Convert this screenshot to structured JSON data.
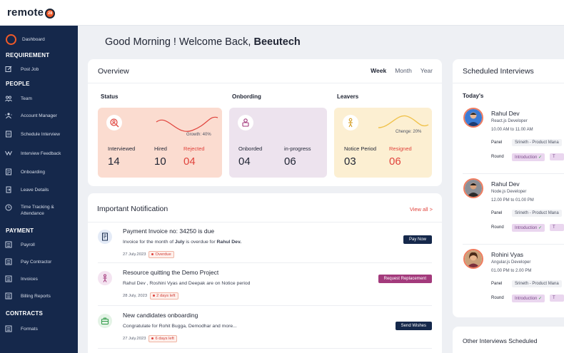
{
  "brand": {
    "name": "remote",
    "badge": "28"
  },
  "sidebar": {
    "dashboard": "Dashboard",
    "sections": [
      {
        "title": "REQUIREMENT",
        "items": [
          {
            "label": "Post Job",
            "icon": "edit-icon"
          }
        ]
      },
      {
        "title": "PEOPLE",
        "items": [
          {
            "label": "Team",
            "icon": "team-icon"
          },
          {
            "label": "Account Manager",
            "icon": "account-manager-icon"
          },
          {
            "label": "Schedule Interview",
            "icon": "calendar-icon"
          },
          {
            "label": "Interview Feedback",
            "icon": "feedback-icon"
          },
          {
            "label": "Onboarding",
            "icon": "onboarding-icon"
          },
          {
            "label": "Leave Details",
            "icon": "leave-icon"
          },
          {
            "label": "Time Tracking & Attendance",
            "icon": "clock-icon"
          }
        ]
      },
      {
        "title": "PAYMENT",
        "items": [
          {
            "label": "Payroll",
            "icon": "payroll-icon"
          },
          {
            "label": "Pay Contractor",
            "icon": "pay-contractor-icon"
          },
          {
            "label": "Invoices",
            "icon": "invoice-icon"
          },
          {
            "label": "Billing Reports",
            "icon": "report-icon"
          }
        ]
      },
      {
        "title": "CONTRACTS",
        "items": [
          {
            "label": "Formats",
            "icon": "formats-icon"
          }
        ]
      }
    ]
  },
  "greeting": {
    "text": "Good Morning ! Welcome Back,",
    "name": "Beeutech"
  },
  "overview": {
    "title": "Overview",
    "tabs": [
      "Week",
      "Month",
      "Year"
    ],
    "active_tab": "Week",
    "status": {
      "label": "Status",
      "growth": "Growth: 40%",
      "interviewed_label": "Interviewed",
      "interviewed": "14",
      "hired_label": "Hired",
      "hired": "10",
      "rejected_label": "Rejected",
      "rejected": "04"
    },
    "onboarding": {
      "label": "Onbording",
      "onborded_label": "Onborded",
      "onborded": "04",
      "progress_label": "in-progress",
      "progress": "06"
    },
    "leavers": {
      "label": "Leavers",
      "change": "Chenge: 20%",
      "notice_label": "Notice Period",
      "notice": "03",
      "resigned_label": "Resigned",
      "resigned": "06"
    }
  },
  "notifications": {
    "title": "Important Notification",
    "view_all": "View all >",
    "items": [
      {
        "title": "Payment Invoice no: 34250 is due",
        "desc_pre": "Invoice for the month of ",
        "desc_month": "July",
        "desc_mid": " is overdue for ",
        "desc_name": "Rahul Dev.",
        "date": "27 July.2023",
        "badge": "Overdue",
        "button": "Pay Now",
        "button_color": "#15284b",
        "icon": "invoice-icon",
        "icon_bg": "#e4ebf7"
      },
      {
        "title": "Resource quitting the Demo Project",
        "desc": "Rahul Dev , Roshini Vyas and Deepak are on Notice period",
        "date": "28 July, 2023",
        "badge": "2 days left",
        "button": "Request Replacement",
        "button_color": "#a33a7c",
        "icon": "person-quit-icon",
        "icon_bg": "#f4e4f1"
      },
      {
        "title": "New candidates onboarding",
        "desc": "Congratulate for Rohit Bugga, Demodhar  and more...",
        "date": "27 July.2023",
        "badge": "6 days left",
        "button": "Send Wishes",
        "button_color": "#15284b",
        "icon": "briefcase-icon",
        "icon_bg": "#e4f3e6"
      }
    ]
  },
  "scheduled": {
    "title": "Scheduled Interviews",
    "today": "Today's",
    "panel_label": "Panel",
    "round_label": "Round",
    "interviews": [
      {
        "name": "Rahul Dev",
        "role": "React.js Developer",
        "time": "10.00 AM  to 11.00 AM",
        "panel": "Srineth - Product Mana",
        "round": "Introduction",
        "round2": "T"
      },
      {
        "name": "Rahul Dev",
        "role": "Node.js Developer",
        "time": "12.00 PM  to 01.00 PM",
        "panel": "Srineth - Product Mana",
        "round": "Introduction",
        "round2": "T"
      },
      {
        "name": "Rohini Vyas",
        "role": "Angular.js Developer",
        "time": "01.00 PM  to 2.00 PM",
        "panel": "Srineth - Product Mana",
        "round": "Introduction",
        "round2": "T"
      }
    ]
  },
  "other": {
    "title": "Other  Interviews Scheduled"
  },
  "colors": {
    "sidebar": "#15284b",
    "accent": "#f25a28",
    "danger": "#e0433c"
  }
}
